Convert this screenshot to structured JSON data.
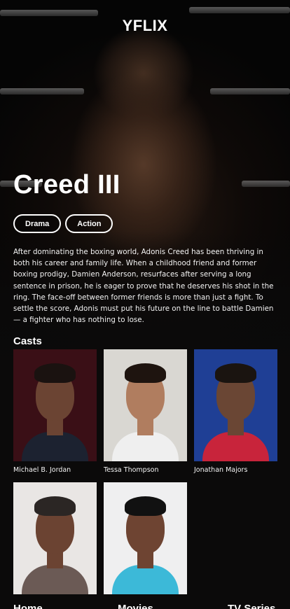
{
  "app": {
    "brand": "YFLIX"
  },
  "movie": {
    "title": "Creed III",
    "genres": [
      "Drama",
      "Action"
    ],
    "overview": "After dominating the boxing world, Adonis Creed has been thriving in both his career and family life. When a childhood friend and former boxing prodigy, Damien Anderson, resurfaces after serving a long sentence in prison, he is eager to prove that he deserves his shot in the ring. The face-off between former friends is more than just a fight. To settle the score, Adonis must put his future on the line to battle Damien — a fighter who has nothing to lose."
  },
  "casts": {
    "heading": "Casts",
    "items": [
      {
        "name": "Michael B. Jordan",
        "colors": {
          "bg": "#3a0f16",
          "skin": "#6b4433",
          "shirt": "#1c2230",
          "hair": "#1a1210"
        }
      },
      {
        "name": "Tessa Thompson",
        "colors": {
          "bg": "#d9d7d2",
          "skin": "#b07d5f",
          "shirt": "#efefef",
          "hair": "#1e140f"
        }
      },
      {
        "name": "Jonathan Majors",
        "colors": {
          "bg": "#1f3f95",
          "skin": "#6a4634",
          "shirt": "#c8243b",
          "hair": "#1a1410"
        }
      },
      {
        "name": "",
        "colors": {
          "bg": "#e9e6e4",
          "skin": "#6b4332",
          "shirt": "#6b5a55",
          "hair": "#2b2624"
        }
      },
      {
        "name": "",
        "colors": {
          "bg": "#efeff0",
          "skin": "#6e4432",
          "shirt": "#3cb9d8",
          "hair": "#111111"
        }
      }
    ]
  },
  "nav": {
    "items": [
      "Home",
      "Movies",
      "TV Series"
    ]
  }
}
